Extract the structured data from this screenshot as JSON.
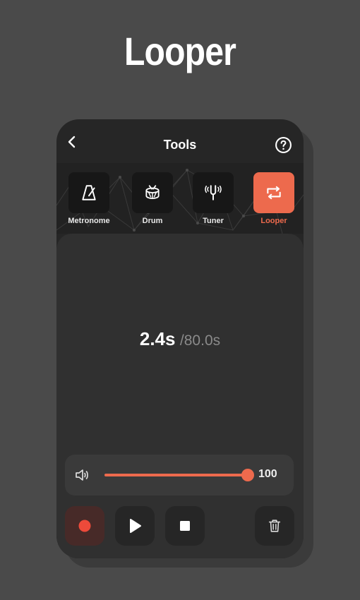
{
  "hero": {
    "title": "Looper"
  },
  "topbar": {
    "title": "Tools",
    "back_icon": "chevron-left-icon",
    "help_icon": "help-circle-icon"
  },
  "tools": [
    {
      "label": "Metronome",
      "icon": "metronome-icon",
      "active": false
    },
    {
      "label": "Drum",
      "icon": "drum-icon",
      "active": false
    },
    {
      "label": "Tuner",
      "icon": "tuning-fork-icon",
      "active": false
    },
    {
      "label": "Looper",
      "icon": "loop-icon",
      "active": true
    }
  ],
  "timer": {
    "current": "2.4s",
    "total": "/80.0s"
  },
  "volume": {
    "value": "100",
    "level": 1.0,
    "icon": "speaker-icon"
  },
  "controls": {
    "record_icon": "record-icon",
    "play_icon": "play-icon",
    "stop_icon": "stop-icon",
    "delete_icon": "trash-icon"
  },
  "colors": {
    "accent": "#ed6a4d",
    "background": "#4a4a4a",
    "phone": "#262626",
    "panel": "#303030"
  }
}
